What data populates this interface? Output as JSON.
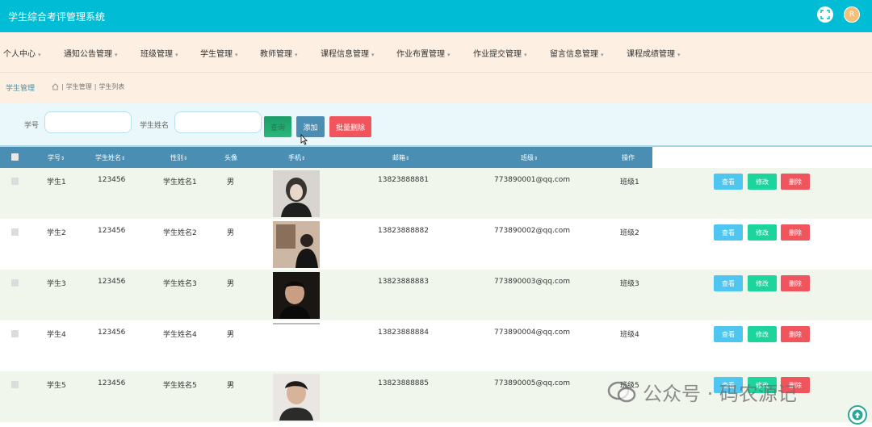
{
  "app": {
    "title": "学生综合考评管理系统",
    "user_initial": "R"
  },
  "nav": [
    {
      "label": "个人中心"
    },
    {
      "label": "通知公告管理"
    },
    {
      "label": "班级管理"
    },
    {
      "label": "学生管理"
    },
    {
      "label": "教师管理"
    },
    {
      "label": "课程信息管理"
    },
    {
      "label": "作业布置管理"
    },
    {
      "label": "作业提交管理"
    },
    {
      "label": "留言信息管理"
    },
    {
      "label": "课程成绩管理"
    }
  ],
  "breadcrumb": {
    "title": "学生管理",
    "path": [
      "学生管理",
      "学生列表"
    ]
  },
  "search": {
    "student_no_label": "学号",
    "student_name_label": "学生姓名",
    "query_label": "查询",
    "add_label": "添加",
    "batch_delete_label": "批量删除"
  },
  "table": {
    "headers": {
      "student_no": "学号",
      "password": "学生姓名",
      "name": "性别",
      "gender": "头像",
      "avatar": "手机",
      "phone": "邮箱",
      "email": "班级",
      "ops": "操作"
    },
    "rows": [
      {
        "no": "学生1",
        "pwd": "123456",
        "name": "学生姓名1",
        "gender": "男",
        "phone": "13823888881",
        "email": "773890001@qq.com",
        "class": "班级1"
      },
      {
        "no": "学生2",
        "pwd": "123456",
        "name": "学生姓名2",
        "gender": "男",
        "phone": "13823888882",
        "email": "773890002@qq.com",
        "class": "班级2"
      },
      {
        "no": "学生3",
        "pwd": "123456",
        "name": "学生姓名3",
        "gender": "男",
        "phone": "13823888883",
        "email": "773890003@qq.com",
        "class": "班级3"
      },
      {
        "no": "学生4",
        "pwd": "123456",
        "name": "学生姓名4",
        "gender": "男",
        "phone": "13823888884",
        "email": "773890004@qq.com",
        "class": "班级4"
      },
      {
        "no": "学生5",
        "pwd": "123456",
        "name": "学生姓名5",
        "gender": "男",
        "phone": "13823888885",
        "email": "773890005@qq.com",
        "class": "班级5"
      }
    ],
    "actions": {
      "view": "查看",
      "edit": "修改",
      "delete": "删除"
    }
  },
  "watermark": {
    "text": "公众号 · 码农源记"
  },
  "colors": {
    "topbar": "#00bcd4",
    "nav_bg": "#fdf0e2",
    "table_header": "#4a8fb3",
    "view": "#4fc6ef",
    "edit": "#1ed49d",
    "delete": "#f0545c"
  }
}
